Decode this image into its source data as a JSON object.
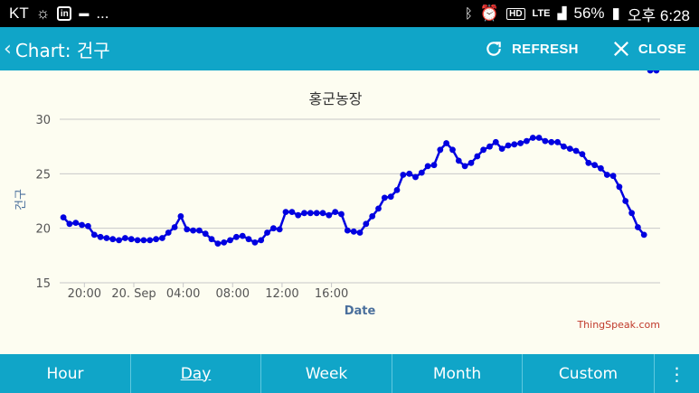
{
  "status_bar": {
    "carrier": "KT",
    "battery": "56%",
    "time": "오후 6:28",
    "network": "LTE",
    "more": "..."
  },
  "toolbar": {
    "back_icon": "chevron-left-icon",
    "title": "Chart: 건구",
    "refresh_label": "REFRESH",
    "close_label": "CLOSE"
  },
  "chart_data": {
    "type": "line",
    "title": "홍군농장",
    "xlabel": "Date",
    "ylabel": "건구",
    "ylim": [
      15,
      30
    ],
    "yticks": [
      15,
      20,
      25,
      30
    ],
    "x_tick_labels": [
      "20:00",
      "20. Sep",
      "04:00",
      "08:00",
      "12:00",
      "16:00"
    ],
    "x_hours": [
      18.3,
      18.8,
      19.3,
      19.8,
      20.3,
      20.8,
      21.3,
      21.8,
      22.3,
      22.8,
      23.3,
      23.8,
      24.3,
      24.8,
      25.3,
      25.8,
      26.3,
      26.8,
      27.3,
      27.8,
      28.3,
      28.8,
      29.3,
      29.8,
      30.3,
      30.8,
      31.3,
      31.8,
      32.3,
      32.8,
      33.3,
      33.8,
      34.3,
      34.8,
      35.3,
      35.8,
      36.3,
      36.8,
      37.3,
      37.8,
      38.3,
      38.8,
      39.3,
      39.8,
      40.3,
      40.8,
      41.3,
      41.8,
      42.3,
      42.8,
      43.3,
      43.8,
      44.3,
      44.8,
      45.3,
      45.8,
      46.3,
      46.8,
      47.3,
      47.8,
      48.3,
      48.8,
      49.3,
      49.8,
      50.3,
      50.8,
      51.3,
      51.8,
      52.3,
      52.8,
      53.3,
      53.8,
      54.3,
      54.8,
      55.3,
      55.8,
      56.3,
      56.8,
      57.3,
      57.8,
      58.3,
      58.8,
      59.3,
      59.8,
      60.3,
      60.8,
      61.3,
      61.8,
      62.3,
      62.8,
      63.3,
      63.8,
      64.3,
      64.8,
      65.3,
      65.8,
      66.3
    ],
    "series": [
      {
        "name": "",
        "color": "#0000e0",
        "values": [
          21.0,
          20.4,
          20.5,
          20.3,
          20.2,
          19.4,
          19.2,
          19.1,
          19.0,
          18.9,
          19.1,
          19.0,
          18.9,
          18.9,
          18.9,
          19.0,
          19.1,
          19.6,
          20.1,
          21.1,
          19.9,
          19.8,
          19.8,
          19.5,
          19.0,
          18.6,
          18.7,
          18.9,
          19.2,
          19.3,
          19.0,
          18.7,
          18.9,
          19.6,
          20.0,
          19.9,
          21.5,
          21.5,
          21.2,
          21.4,
          21.4,
          21.4,
          21.4,
          21.2,
          21.5,
          21.3,
          19.8,
          19.7,
          19.6,
          20.4,
          21.1,
          21.8,
          22.8,
          22.9,
          23.5,
          24.9,
          25.0,
          24.7,
          25.1,
          25.7,
          25.8,
          27.2,
          27.8,
          27.2,
          26.2,
          25.7,
          26.0,
          26.6,
          27.2,
          27.5,
          27.9,
          27.3,
          27.6,
          27.7,
          27.8,
          28.0,
          28.3,
          28.3,
          28.0,
          27.9,
          27.9,
          27.5,
          27.3,
          27.1,
          26.8,
          26.0,
          25.8,
          25.5,
          24.9,
          24.8,
          23.8,
          22.5,
          21.4,
          20.1,
          19.4
        ]
      }
    ],
    "credit": "ThingSpeak.com",
    "grid": true
  },
  "bottom_tabs": [
    {
      "label": "Hour",
      "active": false
    },
    {
      "label": "Day",
      "active": true
    },
    {
      "label": "Week",
      "active": false
    },
    {
      "label": "Month",
      "active": false
    },
    {
      "label": "Custom",
      "active": false
    }
  ],
  "more_icon": "more-vertical-icon"
}
